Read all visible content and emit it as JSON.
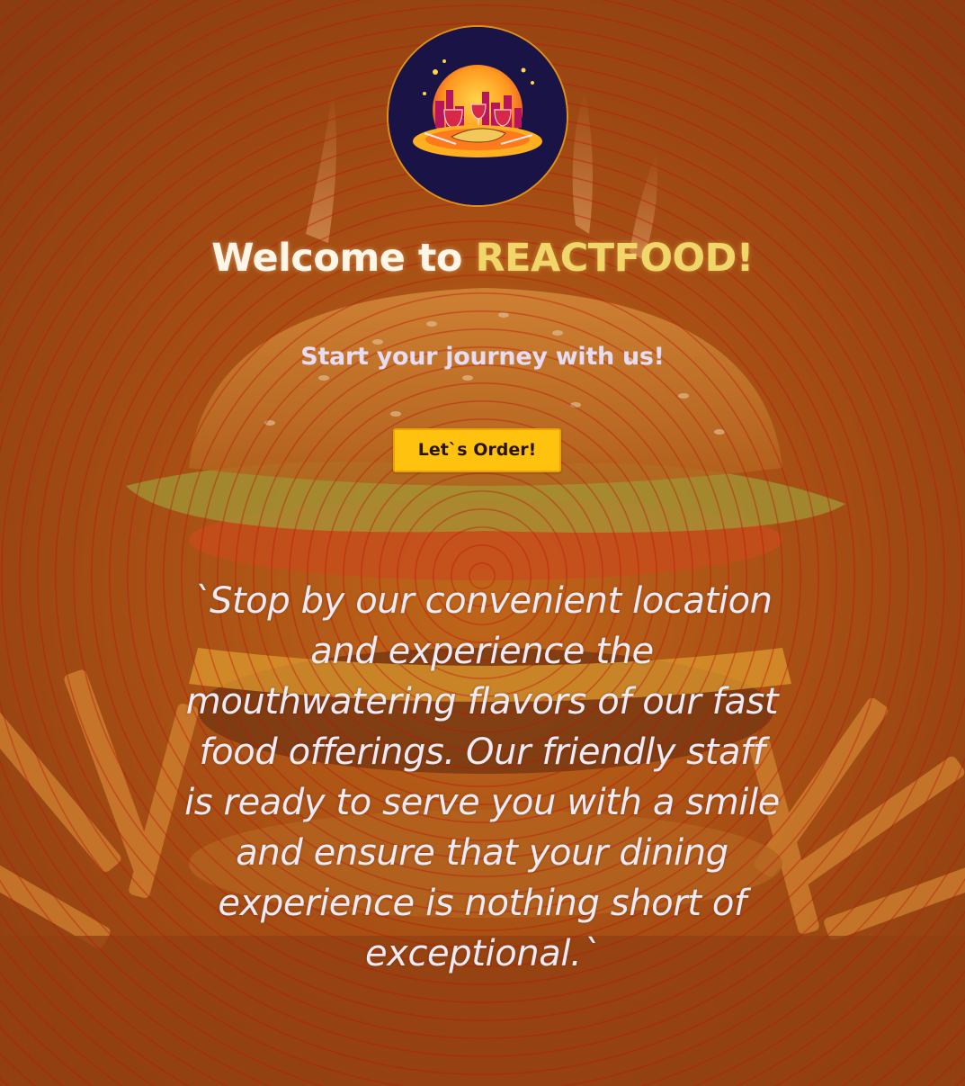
{
  "logo": {
    "icon": "restaurant-logo-icon",
    "colors": {
      "background": "#1a1446",
      "ring": "#e0901a",
      "sun": "#ff9a1f",
      "plate": "#ffb020"
    }
  },
  "hero": {
    "title_prefix": "Welcome to ",
    "title_brand": "REACTFOOD!",
    "tagline": "Start your journey with us!",
    "order_button": "Let`s Order!",
    "description": "`Stop by our convenient location and experience the mouthwatering flavors of our fast food offerings. Our friendly staff is ready to serve you with a smile and ensure that your dining experience is nothing short of exceptional.`"
  },
  "colors": {
    "accent_button": "#ffc20e",
    "brand_text": "#f1d66a",
    "overlay_rings": "#be140a"
  },
  "background": {
    "icon": "burger-and-fries-photo"
  }
}
